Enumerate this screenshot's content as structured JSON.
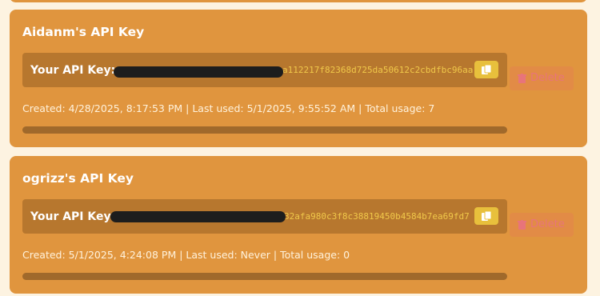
{
  "keys": [
    {
      "title": "Aidanm's API Key",
      "key_label": "Your API Key:",
      "key_visible": "a112217f82368d725da50612c2cbdfbc96aa",
      "meta": "Created: 4/28/2025, 8:17:53 PM | Last used: 5/1/2025, 9:55:52 AM | Total usage: 7",
      "delete_label": "Delete"
    },
    {
      "title": "ogrizz's API Key",
      "key_label": "Your API Key:",
      "key_visible": "32afa980c3f8c38819450b4584b7ea69fd7",
      "meta": "Created: 5/1/2025, 4:24:08 PM | Last used: Never | Total usage: 0",
      "delete_label": "Delete"
    }
  ],
  "icons": {
    "copy": "copy-icon",
    "delete": "trash-icon"
  },
  "colors": {
    "page_bg": "#fdf3e1",
    "card_bg": "#e0953e",
    "key_box_bg": "#b7772e",
    "key_text": "#f0c84a",
    "copy_button": "#e8c03c",
    "delete_text": "#e8747a"
  }
}
